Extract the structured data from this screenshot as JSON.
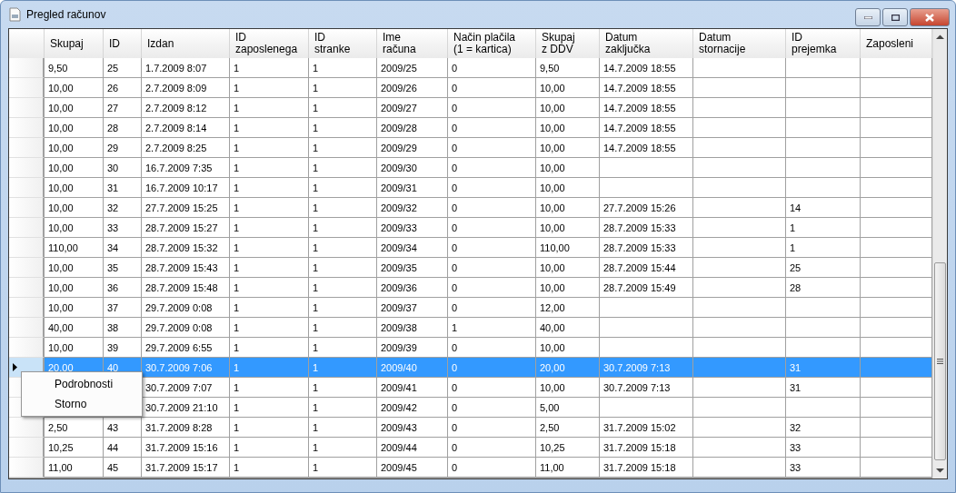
{
  "window": {
    "title": "Pregled računov"
  },
  "table": {
    "columns": [
      "Skupaj",
      "ID",
      "Izdan",
      "ID\nzaposlenega",
      "ID\nstranke",
      "Ime\nračuna",
      "Način plačila\n(1 = kartica)",
      "Skupaj\nz DDV",
      "Datum\nzaključka",
      "Datum\nstornacije",
      "ID\nprejemka",
      "Zaposleni"
    ],
    "rows": [
      {
        "selected": false,
        "cells": [
          "9,50",
          "25",
          "1.7.2009 8:07",
          "1",
          "1",
          "2009/25",
          "0",
          "9,50",
          "14.7.2009 18:55",
          null,
          null,
          null
        ]
      },
      {
        "selected": false,
        "cells": [
          "10,00",
          "26",
          "2.7.2009 8:09",
          "1",
          "1",
          "2009/26",
          "0",
          "10,00",
          "14.7.2009 18:55",
          null,
          null,
          null
        ]
      },
      {
        "selected": false,
        "cells": [
          "10,00",
          "27",
          "2.7.2009 8:12",
          "1",
          "1",
          "2009/27",
          "0",
          "10,00",
          "14.7.2009 18:55",
          null,
          null,
          null
        ]
      },
      {
        "selected": false,
        "cells": [
          "10,00",
          "28",
          "2.7.2009 8:14",
          "1",
          "1",
          "2009/28",
          "0",
          "10,00",
          "14.7.2009 18:55",
          null,
          null,
          null
        ]
      },
      {
        "selected": false,
        "cells": [
          "10,00",
          "29",
          "2.7.2009 8:25",
          "1",
          "1",
          "2009/29",
          "0",
          "10,00",
          "14.7.2009 18:55",
          null,
          null,
          null
        ]
      },
      {
        "selected": false,
        "cells": [
          "10,00",
          "30",
          "16.7.2009 7:35",
          "1",
          "1",
          "2009/30",
          "0",
          "10,00",
          null,
          null,
          null,
          null
        ]
      },
      {
        "selected": false,
        "cells": [
          "10,00",
          "31",
          "16.7.2009 10:17",
          "1",
          "1",
          "2009/31",
          "0",
          "10,00",
          null,
          null,
          null,
          null
        ]
      },
      {
        "selected": false,
        "cells": [
          "10,00",
          "32",
          "27.7.2009 15:25",
          "1",
          "1",
          "2009/32",
          "0",
          "10,00",
          "27.7.2009 15:26",
          null,
          "14",
          null
        ]
      },
      {
        "selected": false,
        "cells": [
          "10,00",
          "33",
          "28.7.2009 15:27",
          "1",
          "1",
          "2009/33",
          "0",
          "10,00",
          "28.7.2009 15:33",
          null,
          "1",
          null
        ]
      },
      {
        "selected": false,
        "cells": [
          "110,00",
          "34",
          "28.7.2009 15:32",
          "1",
          "1",
          "2009/34",
          "0",
          "110,00",
          "28.7.2009 15:33",
          null,
          "1",
          null
        ]
      },
      {
        "selected": false,
        "cells": [
          "10,00",
          "35",
          "28.7.2009 15:43",
          "1",
          "1",
          "2009/35",
          "0",
          "10,00",
          "28.7.2009 15:44",
          null,
          "25",
          null
        ]
      },
      {
        "selected": false,
        "cells": [
          "10,00",
          "36",
          "28.7.2009 15:48",
          "1",
          "1",
          "2009/36",
          "0",
          "10,00",
          "28.7.2009 15:49",
          null,
          "28",
          null
        ]
      },
      {
        "selected": false,
        "cells": [
          "10,00",
          "37",
          "29.7.2009 0:08",
          "1",
          "1",
          "2009/37",
          "0",
          "12,00",
          null,
          null,
          null,
          null
        ]
      },
      {
        "selected": false,
        "cells": [
          "40,00",
          "38",
          "29.7.2009 0:08",
          "1",
          "1",
          "2009/38",
          "1",
          "40,00",
          null,
          null,
          null,
          null
        ]
      },
      {
        "selected": false,
        "cells": [
          "10,00",
          "39",
          "29.7.2009 6:55",
          "1",
          "1",
          "2009/39",
          "0",
          "10,00",
          null,
          null,
          null,
          null
        ]
      },
      {
        "selected": true,
        "cells": [
          "20,00",
          "40",
          "30.7.2009 7:06",
          "1",
          "1",
          "2009/40",
          "0",
          "20,00",
          "30.7.2009 7:13",
          null,
          "31",
          null
        ]
      },
      {
        "selected": false,
        "cells": [
          null,
          null,
          "30.7.2009 7:07",
          "1",
          "1",
          "2009/41",
          "0",
          "10,00",
          "30.7.2009 7:13",
          null,
          "31",
          null
        ]
      },
      {
        "selected": false,
        "cells": [
          null,
          null,
          "30.7.2009 21:10",
          "1",
          "1",
          "2009/42",
          "0",
          "5,00",
          null,
          null,
          null,
          null
        ]
      },
      {
        "selected": false,
        "cells": [
          "2,50",
          "43",
          "31.7.2009 8:28",
          "1",
          "1",
          "2009/43",
          "0",
          "2,50",
          "31.7.2009 15:02",
          null,
          "32",
          null
        ]
      },
      {
        "selected": false,
        "cells": [
          "10,25",
          "44",
          "31.7.2009 15:16",
          "1",
          "1",
          "2009/44",
          "0",
          "10,25",
          "31.7.2009 15:18",
          null,
          "33",
          null
        ]
      },
      {
        "selected": false,
        "cells": [
          "11,00",
          "45",
          "31.7.2009 15:17",
          "1",
          "1",
          "2009/45",
          "0",
          "11,00",
          "31.7.2009 15:18",
          null,
          "33",
          null
        ]
      }
    ]
  },
  "context_menu": {
    "items": [
      "Podrobnosti",
      "Storno"
    ]
  }
}
